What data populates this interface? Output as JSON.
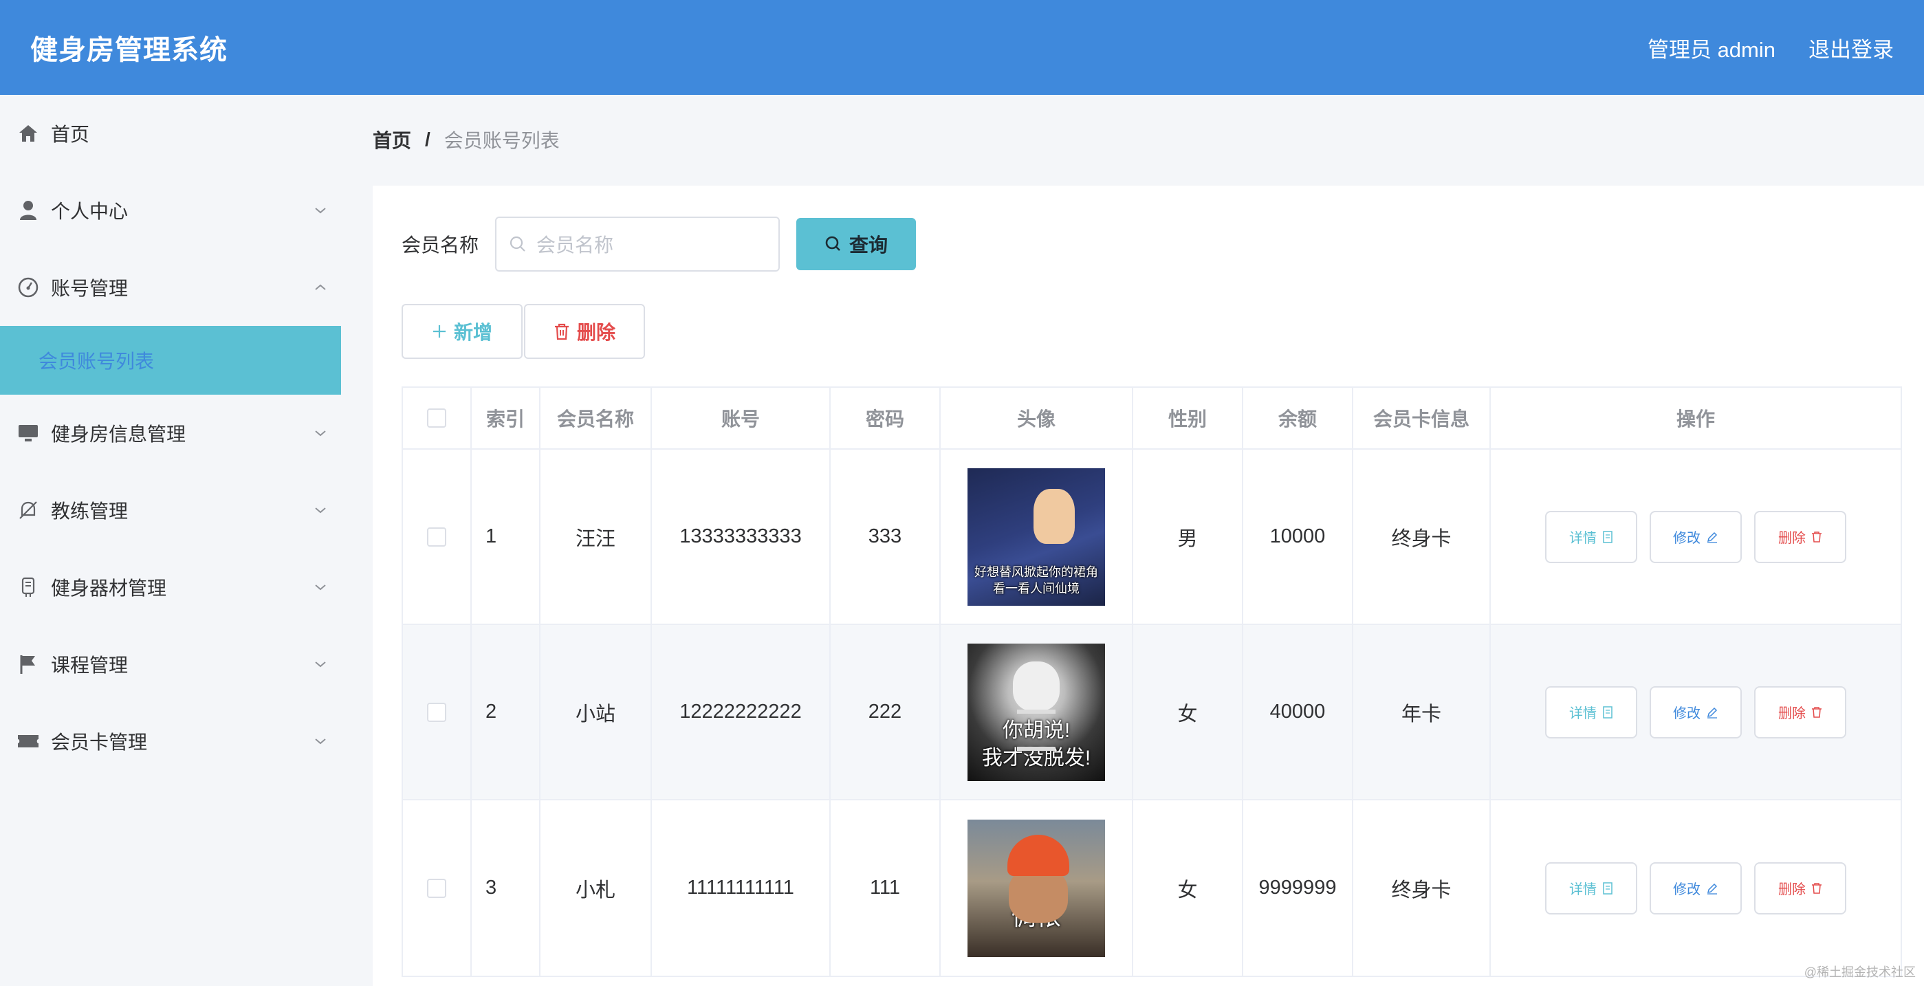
{
  "header": {
    "app_title": "健身房管理系统",
    "user_label": "管理员 admin",
    "logout_label": "退出登录"
  },
  "sidebar": {
    "items": [
      {
        "label": "首页",
        "icon": "home-icon"
      },
      {
        "label": "个人中心",
        "icon": "user-icon"
      },
      {
        "label": "账号管理",
        "icon": "gauge-icon"
      },
      {
        "label": "健身房信息管理",
        "icon": "monitor-icon"
      },
      {
        "label": "教练管理",
        "icon": "bell-off-icon"
      },
      {
        "label": "健身器材管理",
        "icon": "device-icon"
      },
      {
        "label": "课程管理",
        "icon": "flag-icon"
      },
      {
        "label": "会员卡管理",
        "icon": "ticket-icon"
      }
    ],
    "active_sub": "会员账号列表"
  },
  "breadcrumb": {
    "home": "首页",
    "separator": "/",
    "current": "会员账号列表"
  },
  "search": {
    "label": "会员名称",
    "placeholder": "会员名称",
    "button_label": "查询"
  },
  "actions": {
    "add_label": "新增",
    "delete_label": "删除"
  },
  "table": {
    "headers": [
      "索引",
      "会员名称",
      "账号",
      "密码",
      "头像",
      "性别",
      "余额",
      "会员卡信息",
      "操作"
    ],
    "rows": [
      {
        "index": "1",
        "name": "汪汪",
        "account": "13333333333",
        "password": "333",
        "avatar_caption_1": "好想替风掀起你的裙角",
        "avatar_caption_2": "看一看人间仙境",
        "sex": "男",
        "balance": "10000",
        "card": "终身卡"
      },
      {
        "index": "2",
        "name": "小站",
        "account": "12222222222",
        "password": "222",
        "avatar_caption_1": "你胡说!",
        "avatar_caption_2": "我才没脱发!",
        "sex": "女",
        "balance": "40000",
        "card": "年卡"
      },
      {
        "index": "3",
        "name": "小札",
        "account": "11111111111",
        "password": "111",
        "avatar_caption_1": "惆怅",
        "avatar_caption_2": "",
        "sex": "女",
        "balance": "9999999",
        "card": "终身卡"
      }
    ],
    "ops": {
      "detail": "详情",
      "edit": "修改",
      "delete": "删除"
    }
  },
  "watermark": "@稀土掘金技术社区",
  "colors": {
    "header": "#3f89dc",
    "accent": "#5bc0d3",
    "danger": "#e44c4c"
  }
}
